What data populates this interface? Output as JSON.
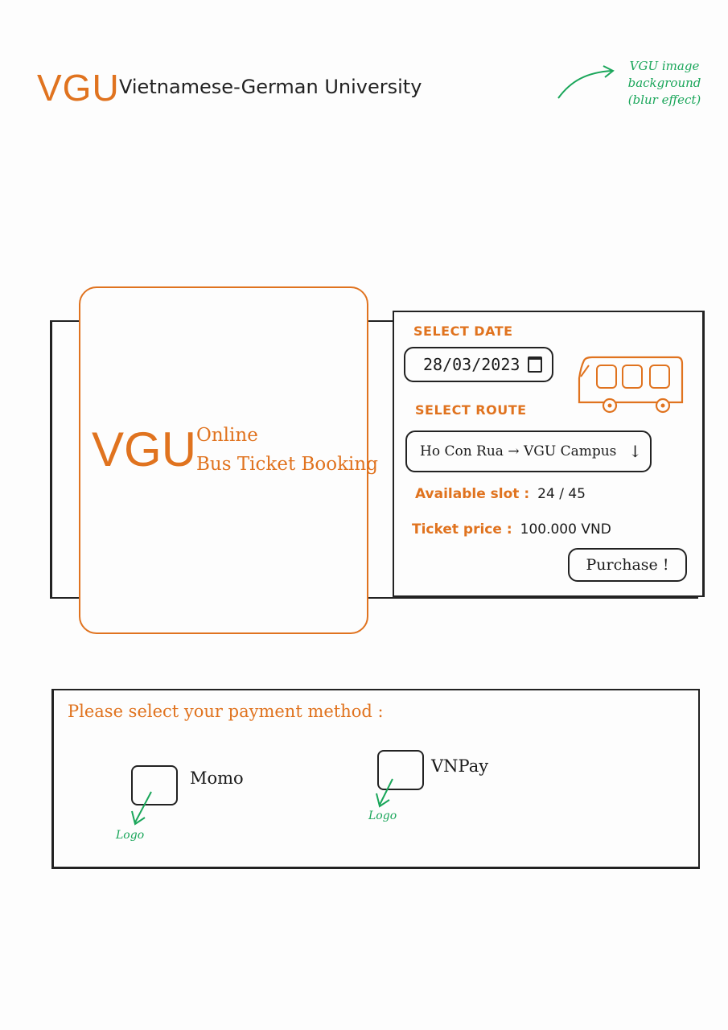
{
  "header": {
    "logo": "VGU",
    "university_name": "Vietnamese-German University"
  },
  "annotations": {
    "background_note_lines": [
      "VGU image",
      "background",
      "(blur effect)"
    ],
    "momo_logo_note": "Logo",
    "vnpay_logo_note": "Logo"
  },
  "hero": {
    "logo": "VGU",
    "line1": "Online",
    "line2": "Bus Ticket Booking"
  },
  "booking": {
    "date_label": "SELECT DATE",
    "date_value": "28/03/2023",
    "route_label": "SELECT ROUTE",
    "route_value": "Ho Con Rua → VGU Campus",
    "slot_label": "Available slot :",
    "slot_value": "24 / 45",
    "price_label": "Ticket price :",
    "price_value": "100.000 VND",
    "purchase_label": "Purchase !"
  },
  "payment": {
    "title": "Please select your payment method :",
    "methods": [
      {
        "name": "Momo"
      },
      {
        "name": "VNPay"
      }
    ]
  },
  "colors": {
    "accent": "#e0731f",
    "annotation": "#1aa65a",
    "ink": "#222222"
  }
}
